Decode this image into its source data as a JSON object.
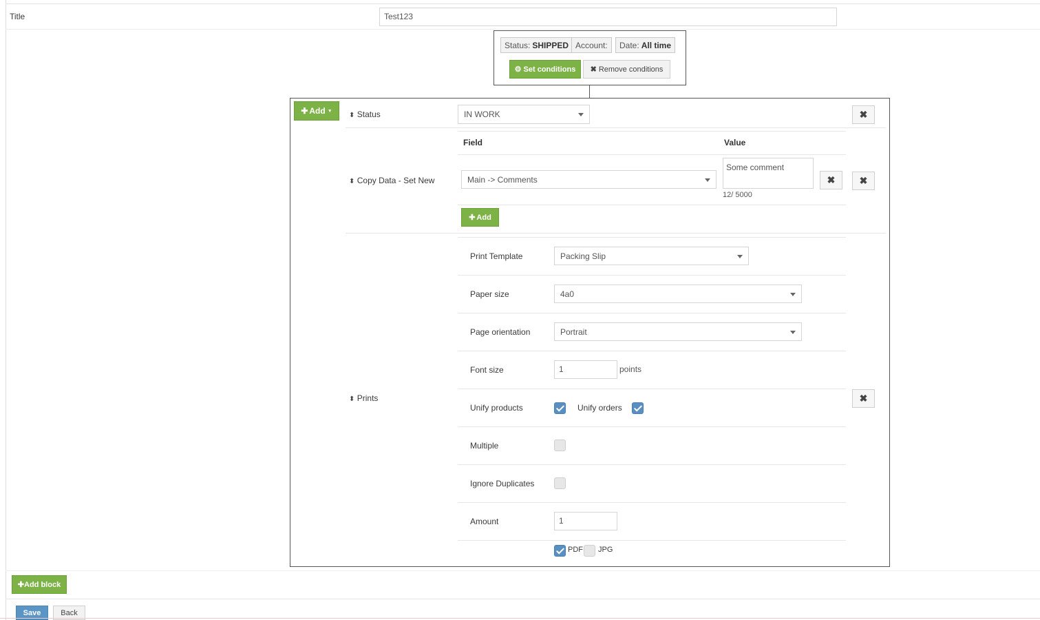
{
  "title_row": {
    "label": "Title",
    "value": "Test123"
  },
  "conditions": {
    "status_label": "Status:",
    "status_value": "SHIPPED",
    "account_label": "Account:",
    "date_label": "Date:",
    "date_value": "All time",
    "set_label": "Set conditions",
    "remove_label": "Remove conditions"
  },
  "block": {
    "add_label": "Add",
    "status_row": {
      "label": "Status",
      "value": "IN WORK"
    },
    "copy_row": {
      "label": "Copy Data - Set New",
      "field_header": "Field",
      "value_header": "Value",
      "field_value": "Main -> Comments",
      "value_text": "Some comment",
      "counter": "12/ 5000",
      "add_label": "Add"
    },
    "prints_row": {
      "label": "Prints",
      "template_label": "Print Template",
      "template_value": "Packing Slip",
      "paper_label": "Paper size",
      "paper_value": "4a0",
      "orientation_label": "Page orientation",
      "orientation_value": "Portrait",
      "font_label": "Font size",
      "font_value": "1",
      "font_unit": "points",
      "unify_products_label": "Unify products",
      "unify_products": true,
      "unify_orders_label": "Unify orders",
      "unify_orders": true,
      "multiple_label": "Multiple",
      "multiple": false,
      "ignore_label": "Ignore Duplicates",
      "ignore": false,
      "amount_label": "Amount",
      "amount_value": "1",
      "pdf_label": "PDF",
      "pdf": true,
      "jpg_label": "JPG",
      "jpg": false
    }
  },
  "footer": {
    "add_block_label": "Add block",
    "save_label": "Save",
    "back_label": "Back"
  }
}
